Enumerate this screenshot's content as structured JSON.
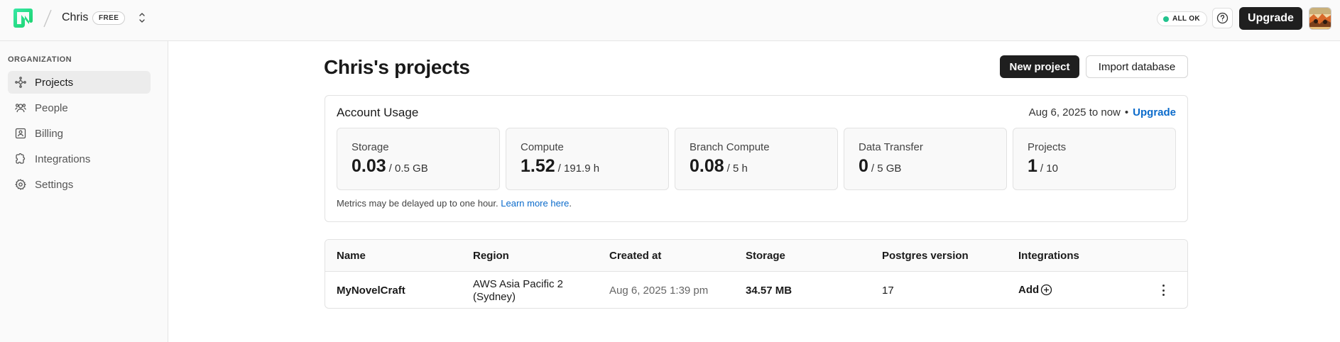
{
  "header": {
    "org_name": "Chris",
    "plan": "FREE",
    "status": "ALL OK",
    "upgrade_label": "Upgrade",
    "icons": [
      "neon-logo-icon",
      "chevron-up-down-icon",
      "help-icon",
      "avatar"
    ]
  },
  "sidebar": {
    "heading": "ORGANIZATION",
    "items": [
      {
        "label": "Projects",
        "icon": "projects-icon",
        "active": true
      },
      {
        "label": "People",
        "icon": "people-icon",
        "active": false
      },
      {
        "label": "Billing",
        "icon": "billing-icon",
        "active": false
      },
      {
        "label": "Integrations",
        "icon": "integrations-icon",
        "active": false
      },
      {
        "label": "Settings",
        "icon": "gear-icon",
        "active": false
      }
    ]
  },
  "main": {
    "title": "Chris's projects",
    "new_project_label": "New project",
    "import_label": "Import database"
  },
  "usage": {
    "title": "Account Usage",
    "range": "Aug 6, 2025 to now",
    "separator": "•",
    "upgrade_link": "Upgrade",
    "metrics": [
      {
        "label": "Storage",
        "value": "0.03",
        "limit": "/ 0.5 GB"
      },
      {
        "label": "Compute",
        "value": "1.52",
        "limit": "/ 191.9 h"
      },
      {
        "label": "Branch Compute",
        "value": "0.08",
        "limit": "/ 5 h"
      },
      {
        "label": "Data Transfer",
        "value": "0",
        "limit": "/ 5 GB"
      },
      {
        "label": "Projects",
        "value": "1",
        "limit": "/ 10"
      }
    ],
    "note": "Metrics may be delayed up to one hour.",
    "note_link": "Learn more here",
    "note_end": "."
  },
  "table": {
    "columns": [
      "Name",
      "Region",
      "Created at",
      "Storage",
      "Postgres version",
      "Integrations"
    ],
    "rows": [
      {
        "name": "MyNovelCraft",
        "region_line1": "AWS Asia Pacific 2",
        "region_line2": "(Sydney)",
        "created": "Aug 6, 2025 1:39 pm",
        "storage": "34.57 MB",
        "pg_version": "17",
        "integrations": "Add"
      }
    ]
  },
  "colors": {
    "accent": "#0b6bcb",
    "status_ok": "#22c38e",
    "dark_button": "#1f1f1f"
  }
}
